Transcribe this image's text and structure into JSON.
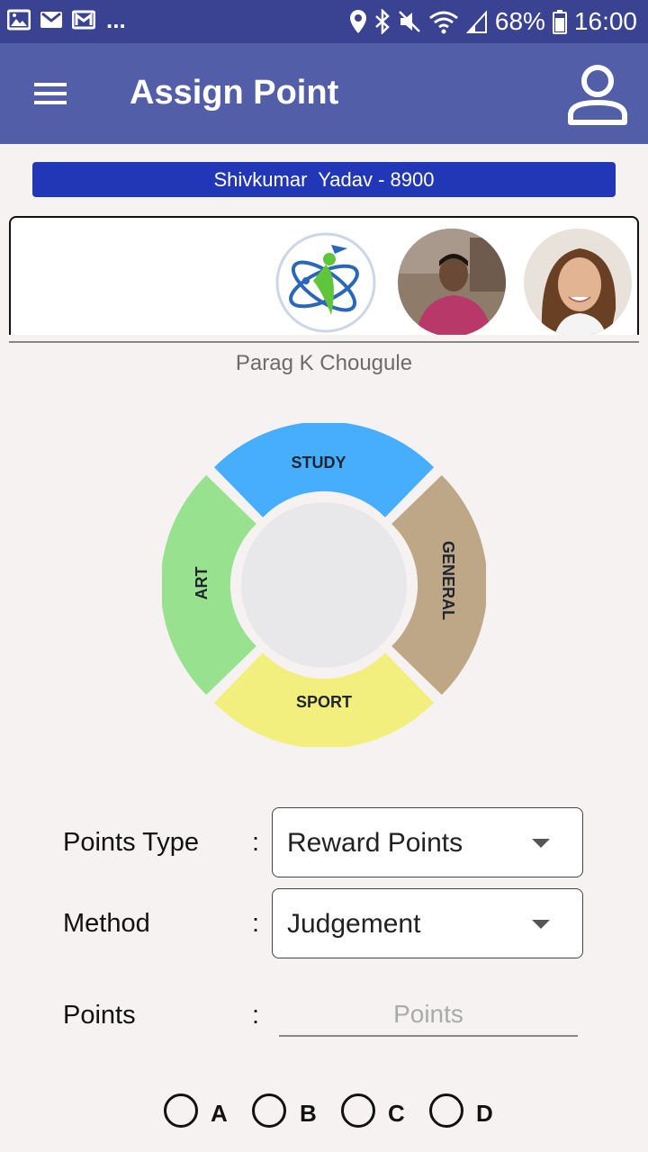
{
  "status_bar": {
    "left_icons": [
      "image-icon",
      "gmail-icon",
      "gmail-alt-icon"
    ],
    "overflow": "...",
    "right_icons": [
      "location-icon",
      "bluetooth-icon",
      "mute-icon",
      "wifi-icon",
      "signal-icon"
    ],
    "battery": "68%",
    "time": "16:00"
  },
  "app_bar": {
    "title": "Assign Point",
    "menu_icon": "hamburger-menu-icon",
    "profile_icon": "person-icon"
  },
  "student_banner": {
    "text": "Shivkumar  Yadav - 8900"
  },
  "avatars": [
    {
      "name": "school-logo"
    },
    {
      "name": "avatar-photo-man"
    },
    {
      "name": "avatar-photo-woman"
    }
  ],
  "teacher_name": "Parag K Chougule",
  "wheel": {
    "segments": [
      {
        "label": "STUDY",
        "color": "#46aefc"
      },
      {
        "label": "GENERAL",
        "color": "#bda786"
      },
      {
        "label": "SPORT",
        "color": "#f2ef7e"
      },
      {
        "label": "ART",
        "color": "#98e28f"
      }
    ],
    "center_color": "#e8e7ea"
  },
  "form": {
    "points_type": {
      "label": "Points Type",
      "colon": ":",
      "value": "Reward Points"
    },
    "method": {
      "label": "Method",
      "colon": ":",
      "value": "Judgement"
    },
    "points": {
      "label": "Points",
      "colon": ":",
      "placeholder": "Points",
      "value": ""
    }
  },
  "options": [
    {
      "label": "A"
    },
    {
      "label": "B"
    },
    {
      "label": "C"
    },
    {
      "label": "D"
    }
  ],
  "colors": {
    "status_bar": "#3a4292",
    "app_bar": "#535ea9",
    "banner": "#2236b8",
    "background": "#f5f2f1"
  }
}
